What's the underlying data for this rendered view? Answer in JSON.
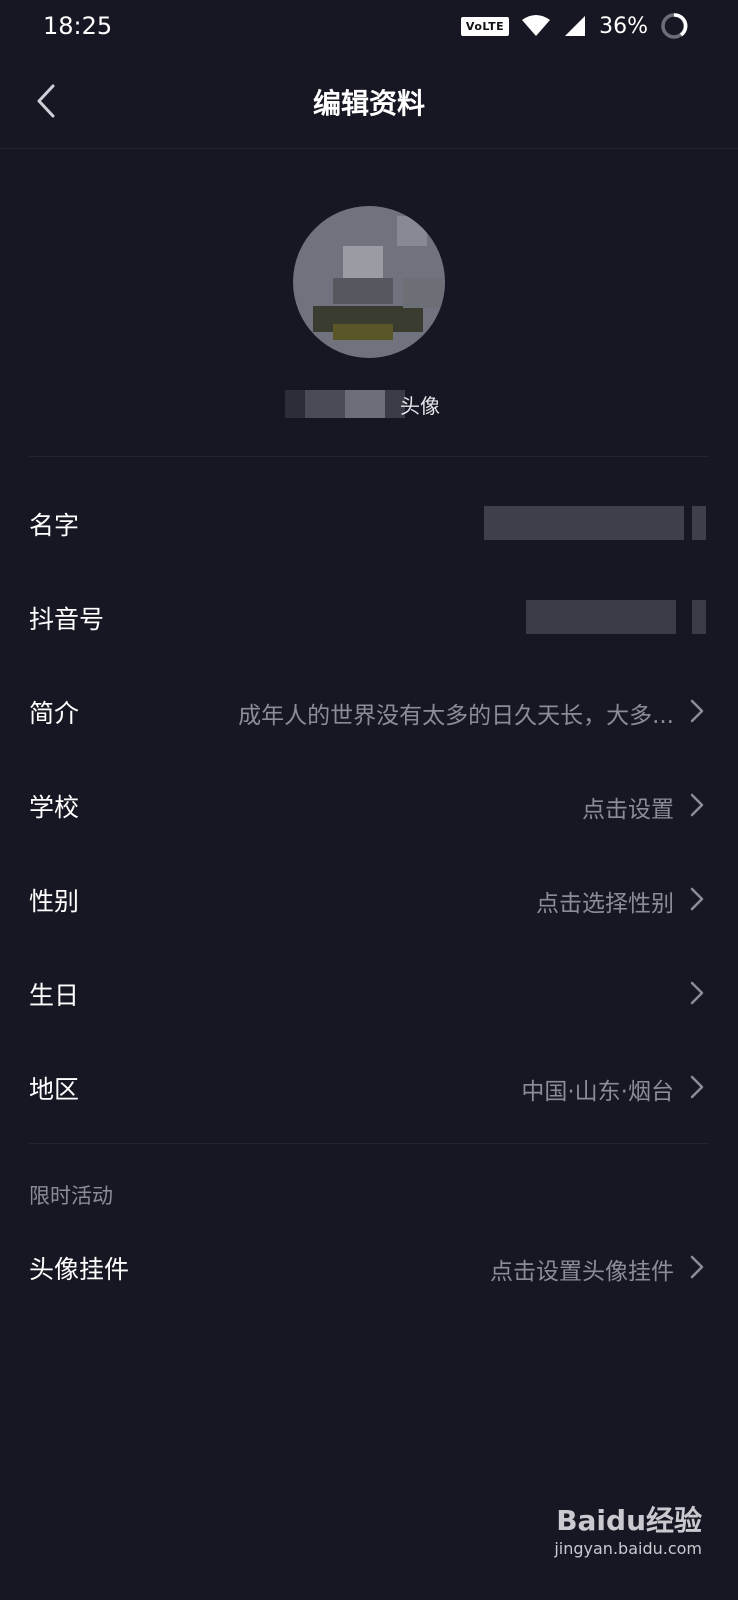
{
  "status_bar": {
    "time": "18:25",
    "network_badge": "VoLTE",
    "battery": "36%"
  },
  "header": {
    "title": "编辑资料"
  },
  "avatar": {
    "change_label": "头像"
  },
  "rows": [
    {
      "label": "名字",
      "value": ""
    },
    {
      "label": "抖音号",
      "value": ""
    },
    {
      "label": "简介",
      "value": "成年人的世界没有太多的日久天长，大多..."
    },
    {
      "label": "学校",
      "value": "点击设置"
    },
    {
      "label": "性别",
      "value": "点击选择性别"
    },
    {
      "label": "生日",
      "value": ""
    },
    {
      "label": "地区",
      "value": "中国·山东·烟台"
    }
  ],
  "section": {
    "title": "限时活动"
  },
  "pendant": {
    "label": "头像挂件",
    "value": "点击设置头像挂件"
  },
  "watermark": {
    "brand": "Baidu经验",
    "url": "jingyan.baidu.com"
  },
  "colors": {
    "background": "#161722",
    "text": "#ffffff",
    "secondary": "#8a8c96",
    "divider": "#232431"
  },
  "icons": [
    "back-arrow-icon",
    "wifi-icon",
    "signal-icon",
    "battery-icon",
    "chevron-right-icon"
  ]
}
